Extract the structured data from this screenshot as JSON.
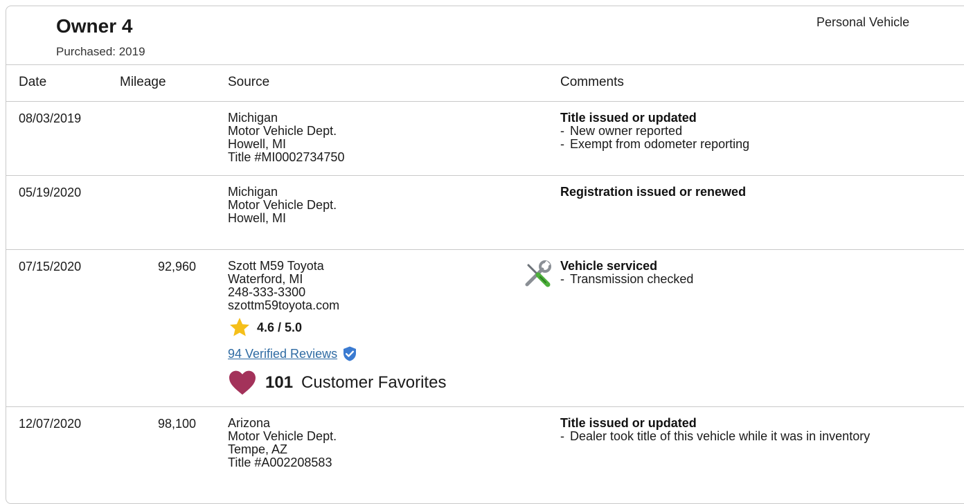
{
  "owner": {
    "title": "Owner 4",
    "purchased": "Purchased: 2019",
    "vehicle_type": "Personal Vehicle"
  },
  "columns": [
    "Date",
    "Mileage",
    "Source",
    "Comments"
  ],
  "records": [
    {
      "date": "08/03/2019",
      "mileage": "",
      "source": [
        "Michigan",
        "Motor Vehicle Dept.",
        "Howell, MI",
        "Title #MI0002734750"
      ],
      "comment_title": "Title issued or updated",
      "comment_items": [
        "New owner reported",
        "Exempt from odometer reporting"
      ]
    },
    {
      "date": "05/19/2020",
      "mileage": "",
      "source": [
        "Michigan",
        "Motor Vehicle Dept.",
        "Howell, MI"
      ],
      "comment_title": "Registration issued or renewed",
      "comment_items": []
    },
    {
      "date": "07/15/2020",
      "mileage": "92,960",
      "source": [
        "Szott M59 Toyota",
        "Waterford, MI",
        "248-333-3300",
        "szottm59toyota.com"
      ],
      "comment_title": "Vehicle serviced",
      "comment_items": [
        "Transmission checked"
      ],
      "comment_icon": "wrench-screwdriver-icon",
      "dealer": {
        "rating": "4.6 / 5.0",
        "reviews": "94 Verified Reviews",
        "favorites_count": "101",
        "favorites_label": "Customer Favorites"
      }
    },
    {
      "date": "12/07/2020",
      "mileage": "98,100",
      "source": [
        "Arizona",
        "Motor Vehicle Dept.",
        "Tempe, AZ",
        "Title #A002208583"
      ],
      "comment_title": "Title issued or updated",
      "comment_items": [
        "Dealer took title of this vehicle while it was in inventory"
      ]
    }
  ],
  "colors": {
    "border": "#c9c9c9",
    "link": "#2f6ba3",
    "star": "#f5bf1a",
    "heart": "#a3325a",
    "verified": "#3b7bd1"
  }
}
